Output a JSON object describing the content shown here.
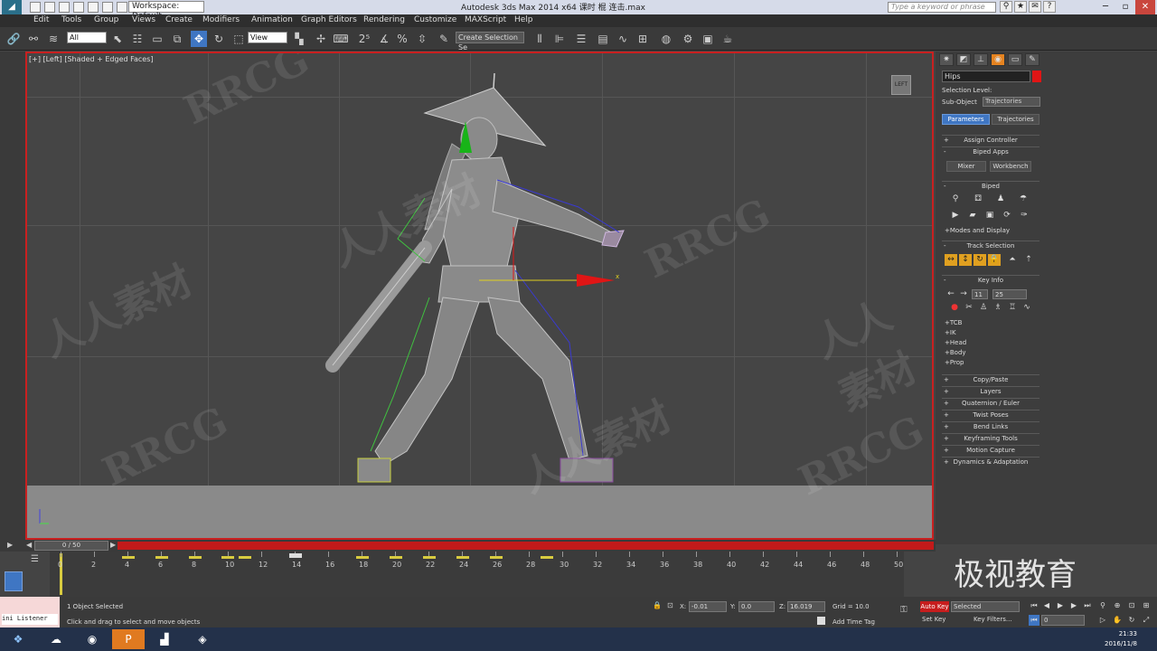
{
  "titlebar": {
    "workspace": "Workspace: Default",
    "title": "Autodesk 3ds Max  2014 x64     课时 棍 连击.max",
    "search_placeholder": "Type a keyword or phrase"
  },
  "menu": [
    "Edit",
    "Tools",
    "Group",
    "Views",
    "Create",
    "Modifiers",
    "Animation",
    "Graph Editors",
    "Rendering",
    "Customize",
    "MAXScript",
    "Help"
  ],
  "toolbar": {
    "filter": "All",
    "refcoord": "View",
    "named_selection": "Create Selection Se"
  },
  "viewport": {
    "label": "[+] [Left] [Shaded + Edged Faces]",
    "viewcube": "LEFT",
    "gizmo_axis": "x",
    "watermarks": [
      "RRCG",
      "人人素材",
      "RRCG",
      "人人素材",
      "RRCG",
      "人人素材",
      "RRCG",
      "人人素材"
    ]
  },
  "command_panel": {
    "object_name": "Hips",
    "selection_level_label": "Selection Level:",
    "sub_object_label": "Sub-Object",
    "sub_object_value": "Trajectories",
    "tab_parameters": "Parameters",
    "tab_trajectories": "Trajectories",
    "assign_controller": "Assign Controller",
    "biped_apps": "Biped Apps",
    "mixer": "Mixer",
    "workbench": "Workbench",
    "biped": "Biped",
    "modes_display": "Modes and Display",
    "track_selection": "Track Selection",
    "key_info": "Key Info",
    "key_number": "11",
    "key_time": "25",
    "key_sections": [
      "TCB",
      "IK",
      "Head",
      "Body",
      "Prop"
    ],
    "rollouts": [
      "Copy/Paste",
      "Layers",
      "Quaternion / Euler",
      "Twist Poses",
      "Bend Links",
      "Keyframing Tools",
      "Motion Capture",
      "Dynamics & Adaptation"
    ]
  },
  "timeline": {
    "slider": "0 / 50",
    "ticks": [
      "0",
      "2",
      "4",
      "6",
      "8",
      "10",
      "12",
      "14",
      "16",
      "18",
      "20",
      "22",
      "24",
      "26",
      "28",
      "30",
      "32",
      "34",
      "36",
      "38",
      "40",
      "42",
      "44",
      "46",
      "48",
      "50"
    ]
  },
  "status": {
    "listener": "ini Listener",
    "selected": "1 Object Selected",
    "prompt": "Click and drag to select and move objects",
    "x_label": "X:",
    "x": "-0.01",
    "y_label": "Y:",
    "y": "0.0",
    "z_label": "Z:",
    "z": "16.019",
    "grid": "Grid = 10.0",
    "add_time_tag": "Add Time Tag",
    "auto_key": "Auto Key",
    "set_key": "Set Key",
    "selected_dropdown": "Selected",
    "key_filters": "Key Filters...",
    "frame": "0"
  },
  "brand": "极视教育",
  "clock": {
    "time": "21:33",
    "date": "2016/11/8"
  },
  "colors": {
    "accent": "#3f76c3",
    "autokey": "#c61d1d",
    "viewport_border": "#c92020",
    "key": "#d8cb40"
  }
}
